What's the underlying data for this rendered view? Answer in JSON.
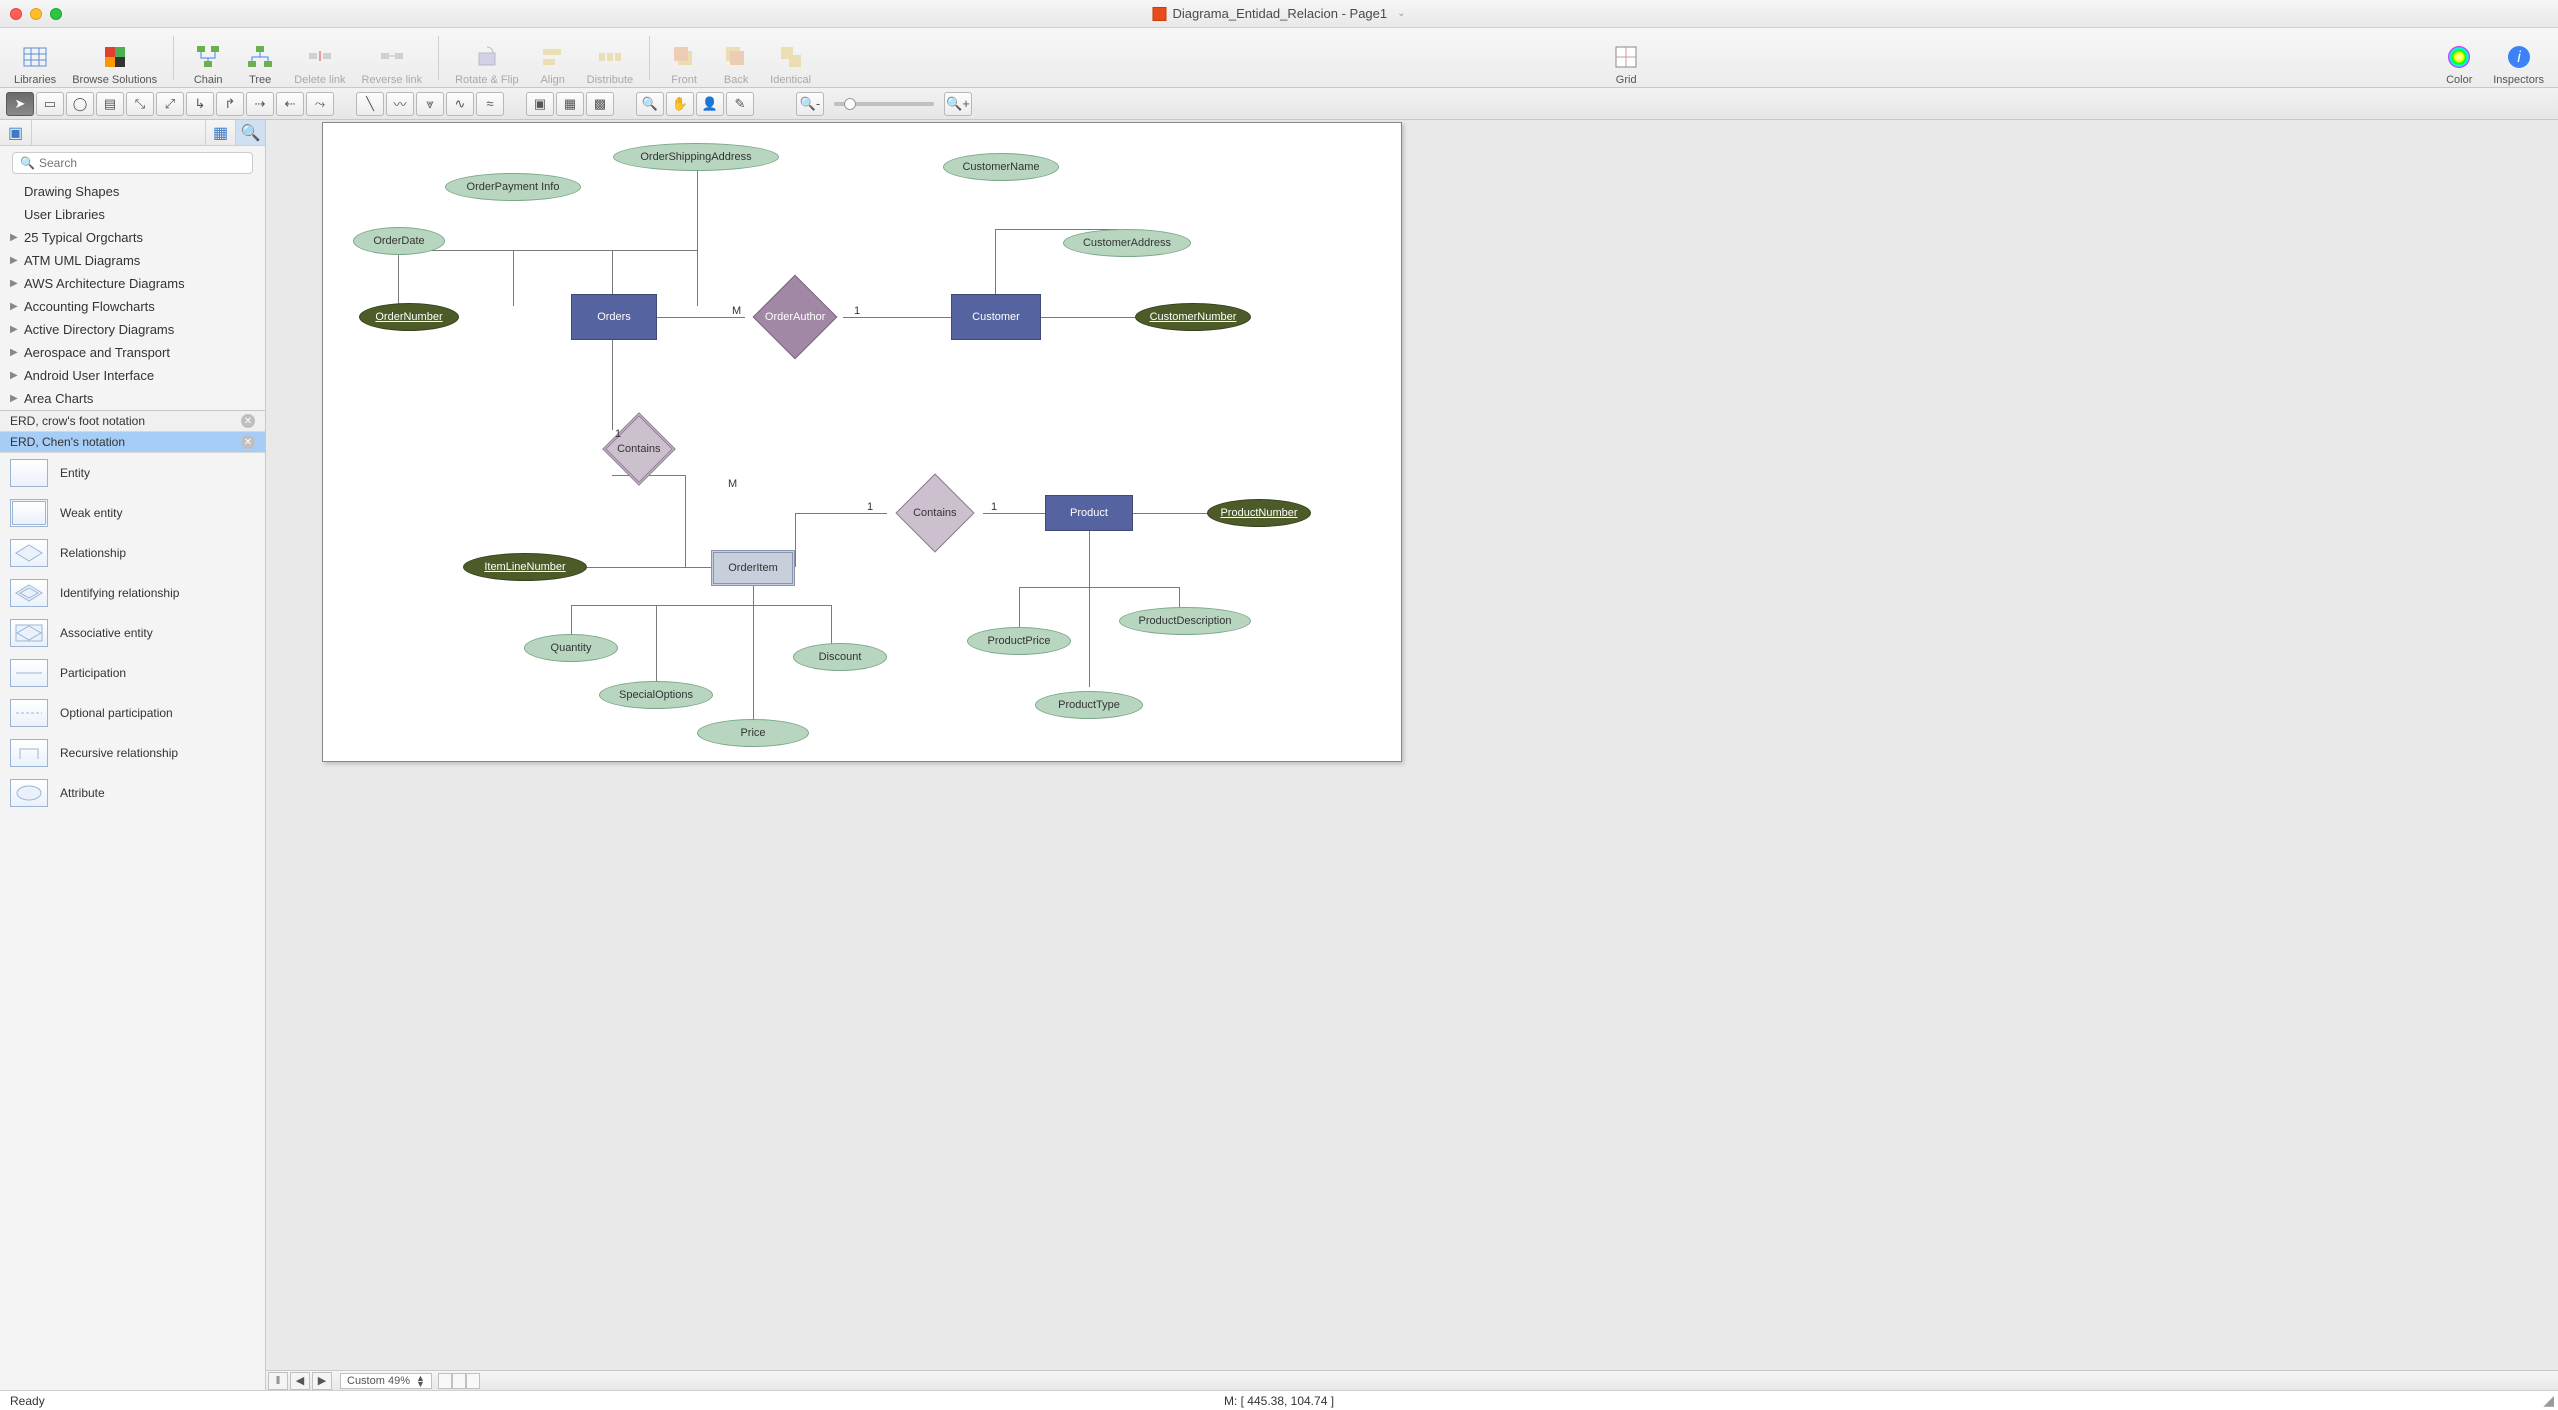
{
  "window": {
    "title": "Diagrama_Entidad_Relacion - Page1"
  },
  "toolbar": {
    "libraries": "Libraries",
    "browse": "Browse Solutions",
    "chain": "Chain",
    "tree": "Tree",
    "delete_link": "Delete link",
    "reverse_link": "Reverse link",
    "rotate_flip": "Rotate & Flip",
    "align": "Align",
    "distribute": "Distribute",
    "front": "Front",
    "back": "Back",
    "identical": "Identical",
    "grid": "Grid",
    "color": "Color",
    "inspectors": "Inspectors"
  },
  "sidebar": {
    "search_placeholder": "Search",
    "tree": [
      "Drawing Shapes",
      "User Libraries",
      "25 Typical Orgcharts",
      "ATM UML Diagrams",
      "AWS Architecture Diagrams",
      "Accounting Flowcharts",
      "Active Directory Diagrams",
      "Aerospace and Transport",
      "Android User Interface",
      "Area Charts"
    ],
    "stencil_crow": "ERD, crow's foot notation",
    "stencil_chen": "ERD, Chen's notation",
    "shapes": [
      "Entity",
      "Weak entity",
      "Relationship",
      "Identifying relationship",
      "Associative entity",
      "Participation",
      "Optional participation",
      "Recursive relationship",
      "Attribute"
    ]
  },
  "erd": {
    "entities": {
      "orders": "Orders",
      "customer": "Customer",
      "orderitem": "OrderItem",
      "product": "Product"
    },
    "relationships": {
      "order_author": "OrderAuthor",
      "contains1": "Contains",
      "contains2": "Contains"
    },
    "key_attrs": {
      "order_number": "OrderNumber",
      "customer_number": "CustomerNumber",
      "item_line_number": "ItemLineNumber",
      "product_number": "ProductNumber"
    },
    "attrs": {
      "order_date": "OrderDate",
      "order_payment": "OrderPayment Info",
      "order_shipping": "OrderShippingAddress",
      "customer_name": "CustomerName",
      "customer_address": "CustomerAddress",
      "quantity": "Quantity",
      "special_options": "SpecialOptions",
      "price": "Price",
      "discount": "Discount",
      "product_price": "ProductPrice",
      "product_description": "ProductDescription",
      "product_type": "ProductType"
    },
    "card": {
      "M": "M",
      "one": "1"
    }
  },
  "bottombar": {
    "zoom": "Custom 49%"
  },
  "status": {
    "ready": "Ready",
    "coords": "M: [ 445.38, 104.74 ]"
  }
}
